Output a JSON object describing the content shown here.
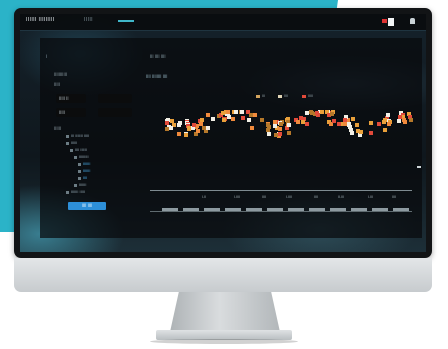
{
  "app": {
    "brand": "IIIIII IIIIIIIII",
    "nav": "IIIII"
  },
  "breadcrumb": {
    "first": "I",
    "second": "III IIII IIII"
  },
  "filters": {
    "label_top": "IIIIIIIIIII",
    "chip_a": "IIIII II",
    "chip_b": "",
    "label_mid": "IIIII",
    "chip_c": "IIIII",
    "chip_d": "",
    "section": "IIIIII"
  },
  "tree": [
    {
      "label": "III IIIIIII IIIII"
    },
    {
      "label": "IIIIII"
    },
    {
      "label": "IIII IIIIII"
    },
    {
      "label": "IIIIIIIII"
    },
    {
      "label": "IIIIIII"
    },
    {
      "label": "IIIIIII"
    },
    {
      "label": "IIII"
    },
    {
      "label": "IIIIIII"
    },
    {
      "label": "IIIIIII IIIII"
    }
  ],
  "apply_label": "IIII IIII",
  "panel": {
    "title": "IIII IIIIIIII IIII"
  },
  "legend": [
    {
      "label": "III",
      "color": "#d3a45e"
    },
    {
      "label": "IIII",
      "color": "#e0d4b5"
    },
    {
      "label": "IIIII",
      "color": "#e24a3a"
    }
  ],
  "timeline": {
    "ticks": [
      "I.II",
      "I.IIII",
      "IIII",
      "I.IIII",
      "IIII",
      "II.III",
      "I.III",
      "IIII"
    ]
  },
  "colors": {
    "accent": "#3fb6c9",
    "button": "#2d8fd8",
    "heat_low": "#e24a3a",
    "heat_mid": "#e9a03a",
    "heat_high": "#f3f0e6"
  }
}
